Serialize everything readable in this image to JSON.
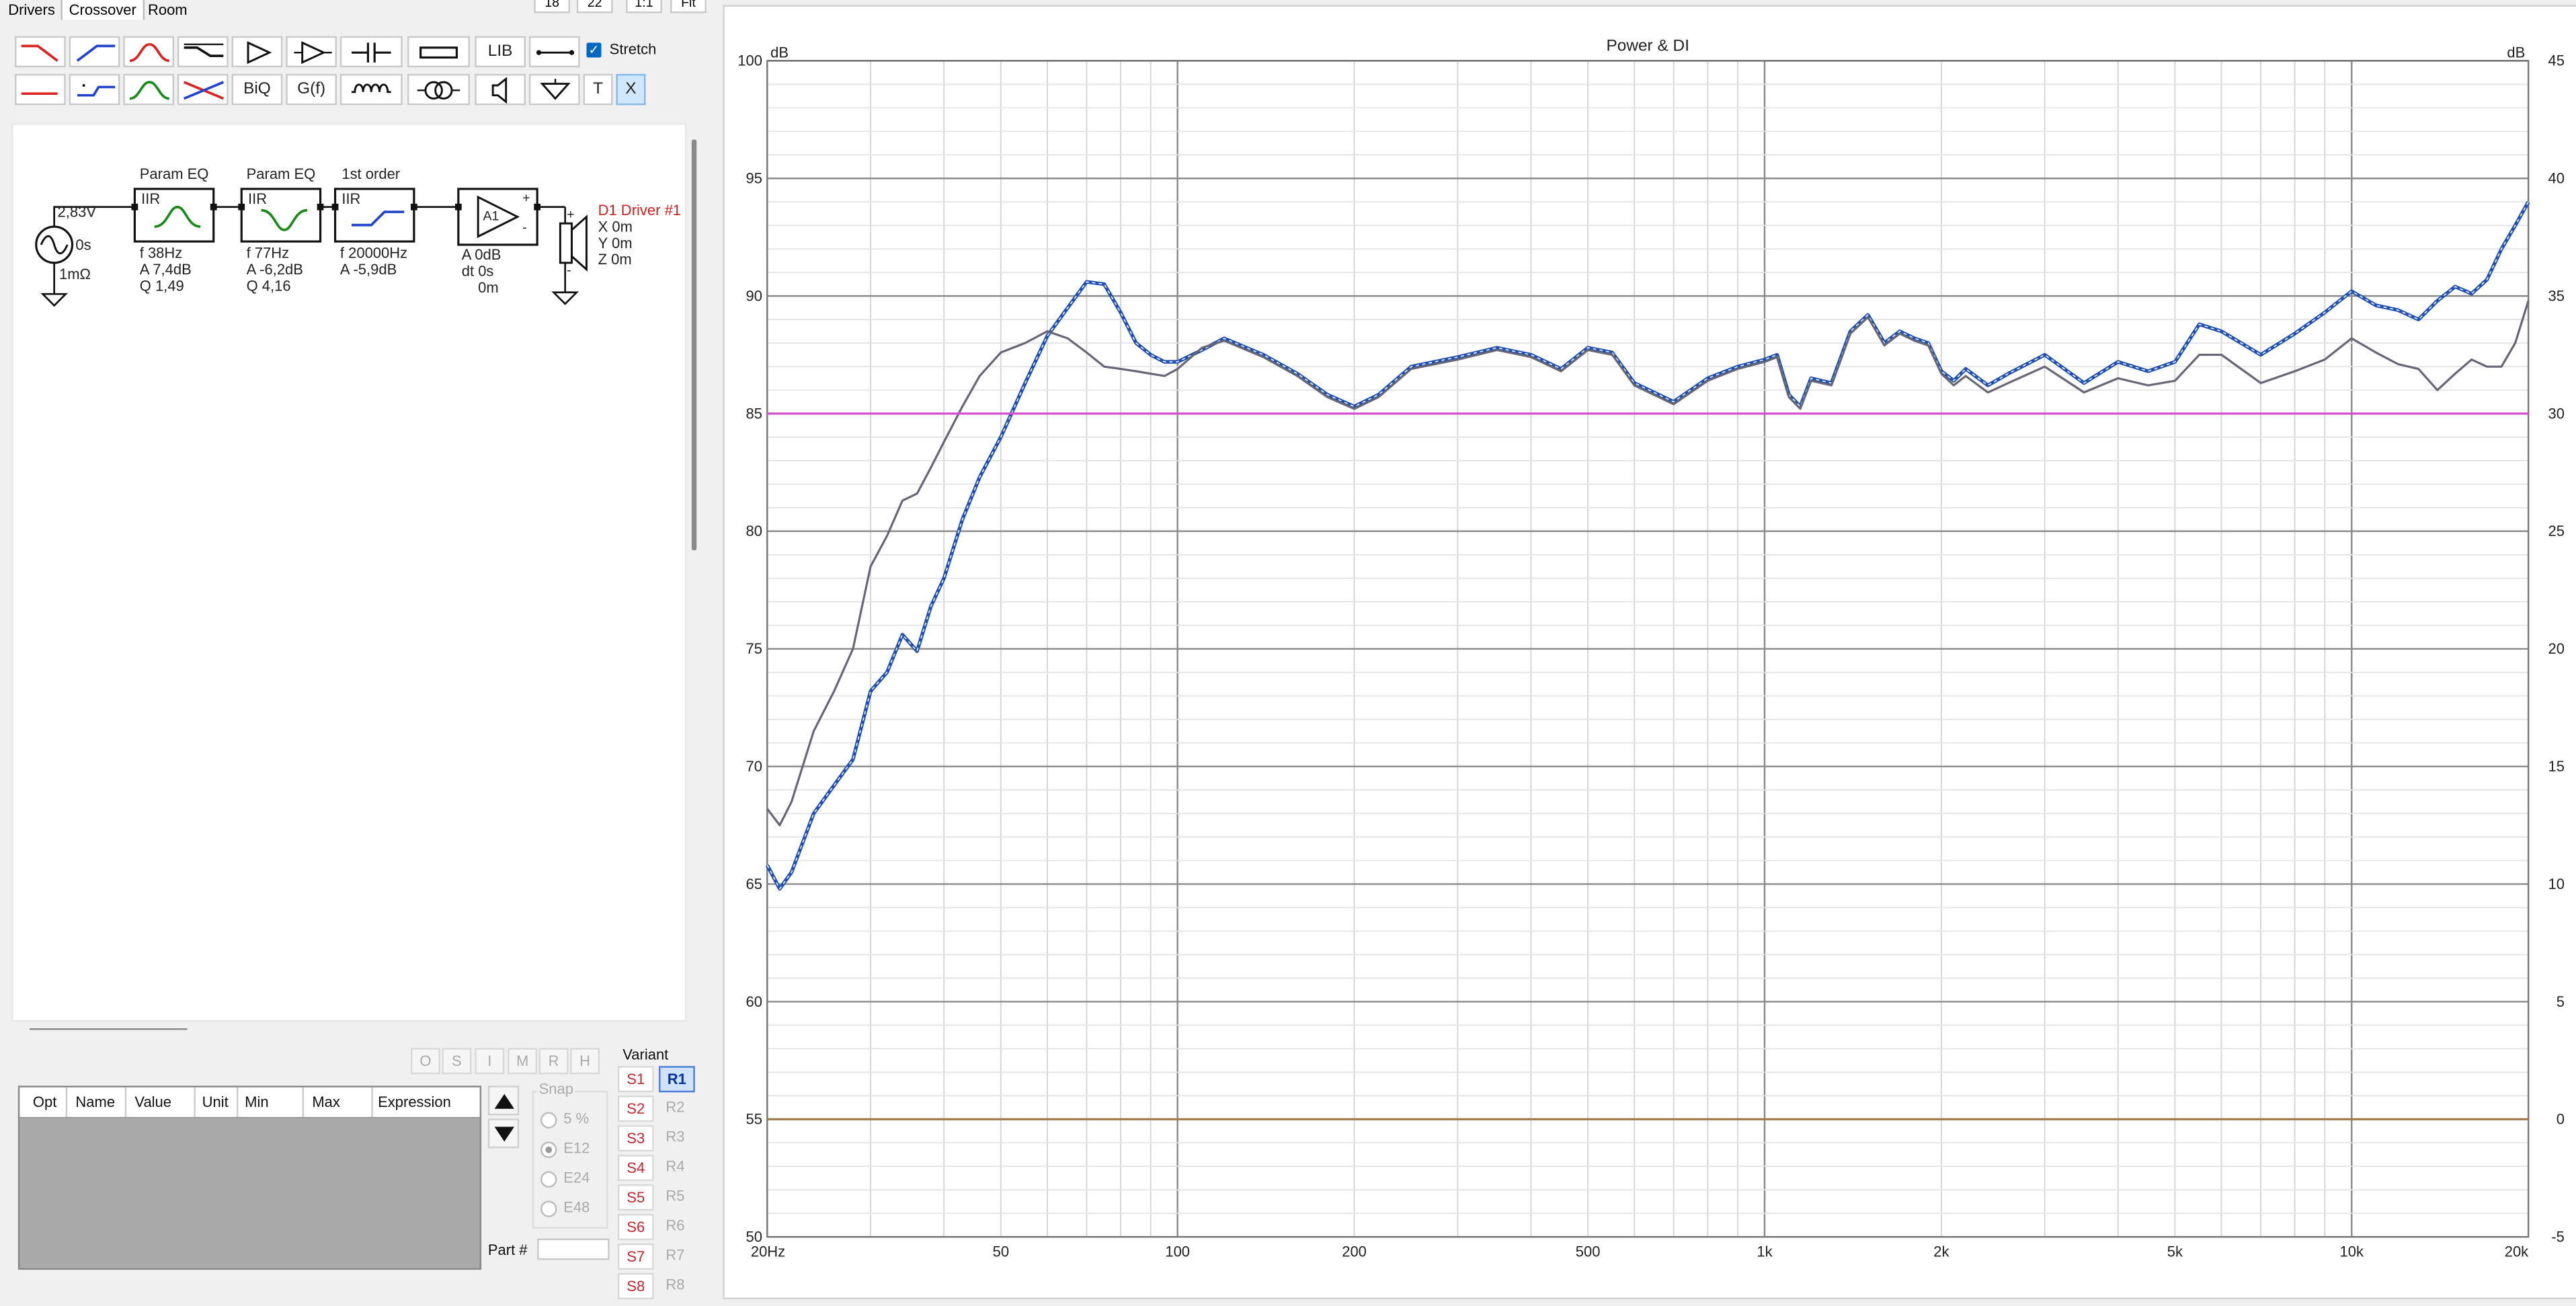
{
  "tabs": [
    {
      "label": "Drivers",
      "active": false
    },
    {
      "label": "Crossover",
      "active": true
    },
    {
      "label": "Room",
      "active": false
    }
  ],
  "top_small_buttons": [
    "18",
    "22",
    "1:1",
    "Fit"
  ],
  "toolbar": {
    "row1_icons": [
      "lowpass-red-icon",
      "highpass-blue-icon",
      "bandpass-red-icon",
      "shelf-black-icon",
      "buffer-triangle-icon",
      "amp-triangle-icon",
      "capacitor-icon",
      "resistor-icon"
    ],
    "row2_icons": [
      "lowpass-red-small-icon",
      "highpass-blue-small-icon",
      "bandpass-green-icon",
      "crossover-x-icon"
    ],
    "lib_label": "LIB",
    "biq_label": "BiQ",
    "gf_label": "G(f)",
    "t_label": "T",
    "x_label": "X",
    "stretch_label": "Stretch",
    "stretch_checked": true
  },
  "schematic": {
    "source": {
      "voltage": "2,83V",
      "delay": "0s",
      "impedance": "1mΩ"
    },
    "blocks": [
      {
        "title": "Param EQ",
        "type": "IIR",
        "params": [
          "f  38Hz",
          "A  7,4dB",
          "Q  1,49"
        ],
        "curve_color": "#1a8a1a",
        "shape": "peak"
      },
      {
        "title": "Param EQ",
        "type": "IIR",
        "params": [
          "f  77Hz",
          "A  -6,2dB",
          "Q  4,16"
        ],
        "curve_color": "#1a8a1a",
        "shape": "dip"
      },
      {
        "title": "1st order",
        "type": "IIR",
        "params": [
          "f  20000Hz",
          "A  -5,9dB"
        ],
        "curve_color": "#2244cc",
        "shape": "highpass"
      }
    ],
    "amp": {
      "label": "A1",
      "params": [
        "A  0dB",
        "dt 0s",
        "0m"
      ]
    },
    "driver": {
      "name": "D1 Driver #1",
      "coords": [
        "X 0m",
        "Y 0m",
        "Z 0m"
      ],
      "color": "#cc2222"
    }
  },
  "opt_buttons": [
    "O",
    "S",
    "I",
    "M",
    "R",
    "H"
  ],
  "param_table": {
    "columns": [
      "Opt",
      "Name",
      "Value",
      "Unit",
      "Min",
      "Max",
      "Expression"
    ]
  },
  "snap": {
    "title": "Snap",
    "options": [
      {
        "label": "5 %",
        "selected": false
      },
      {
        "label": "E12",
        "selected": true
      },
      {
        "label": "E24",
        "selected": false
      },
      {
        "label": "E48",
        "selected": false
      }
    ]
  },
  "part": {
    "label": "Part #",
    "value": ""
  },
  "variant": {
    "title": "Variant",
    "s": [
      "S1",
      "S2",
      "S3",
      "S4",
      "S5",
      "S6",
      "S7",
      "S8"
    ],
    "r": [
      "R1",
      "R2",
      "R3",
      "R4",
      "R5",
      "R6",
      "R7",
      "R8"
    ],
    "active": "R1"
  },
  "chart_data": {
    "type": "line",
    "title": "Power & DI",
    "xscale": "log",
    "xlim": [
      20,
      20000
    ],
    "xticks": [
      {
        "v": 20,
        "label": "20Hz"
      },
      {
        "v": 50,
        "label": "50"
      },
      {
        "v": 100,
        "label": "100"
      },
      {
        "v": 200,
        "label": "200"
      },
      {
        "v": 500,
        "label": "500"
      },
      {
        "v": 1000,
        "label": "1k"
      },
      {
        "v": 2000,
        "label": "2k"
      },
      {
        "v": 5000,
        "label": "5k"
      },
      {
        "v": 10000,
        "label": "10k"
      },
      {
        "v": 20000,
        "label": "20k"
      }
    ],
    "left_axis": {
      "unit": "dB",
      "ylim": [
        50,
        100
      ],
      "ticks": [
        50,
        55,
        60,
        65,
        70,
        75,
        80,
        85,
        90,
        95,
        100
      ]
    },
    "right_axis": {
      "unit": "dB",
      "ylim": [
        -5,
        45
      ],
      "ticks": [
        -5,
        0,
        5,
        10,
        15,
        20,
        25,
        30,
        35,
        40,
        45
      ]
    },
    "grid": true,
    "series": [
      {
        "color": "#1f4fb0",
        "style": "dashed-double",
        "axis": "left",
        "x": [
          20,
          21,
          22,
          24,
          26,
          28,
          30,
          32,
          34,
          36,
          38,
          40,
          43,
          46,
          50,
          55,
          60,
          65,
          70,
          75,
          80,
          85,
          90,
          95,
          100,
          110,
          120,
          140,
          160,
          180,
          200,
          220,
          250,
          300,
          350,
          400,
          450,
          500,
          550,
          600,
          700,
          800,
          900,
          1000,
          1050,
          1100,
          1150,
          1200,
          1300,
          1400,
          1500,
          1600,
          1700,
          1800,
          1900,
          2000,
          2100,
          2200,
          2400,
          2600,
          3000,
          3500,
          4000,
          4500,
          5000,
          5500,
          6000,
          7000,
          8000,
          9000,
          10000,
          11000,
          12000,
          13000,
          14000,
          15000,
          16000,
          17000,
          18000,
          19000,
          20000
        ],
        "y": [
          65.8,
          64.8,
          65.5,
          68.0,
          69.2,
          70.3,
          73.2,
          74.0,
          75.6,
          74.9,
          76.8,
          78.0,
          80.5,
          82.3,
          84.0,
          86.3,
          88.3,
          89.5,
          90.6,
          90.5,
          89.3,
          88.0,
          87.5,
          87.2,
          87.2,
          87.7,
          88.2,
          87.5,
          86.7,
          85.8,
          85.3,
          85.8,
          87.0,
          87.4,
          87.8,
          87.5,
          86.9,
          87.8,
          87.6,
          86.3,
          85.5,
          86.5,
          87.0,
          87.3,
          87.5,
          85.8,
          85.3,
          86.5,
          86.3,
          88.5,
          89.2,
          88.0,
          88.5,
          88.2,
          88.0,
          86.8,
          86.4,
          86.9,
          86.2,
          86.7,
          87.5,
          86.3,
          87.2,
          86.8,
          87.2,
          88.8,
          88.5,
          87.5,
          88.4,
          89.3,
          90.2,
          89.6,
          89.4,
          89.0,
          89.8,
          90.4,
          90.1,
          90.7,
          92.0,
          93.0,
          94.0
        ]
      },
      {
        "color": "#666677",
        "style": "solid",
        "axis": "left",
        "x": [
          20,
          21,
          22,
          24,
          26,
          28,
          30,
          32,
          34,
          36,
          38,
          40,
          43,
          46,
          50,
          55,
          60,
          65,
          70,
          75,
          80,
          85,
          90,
          95,
          100,
          110,
          120,
          140,
          160,
          180,
          200,
          220,
          250,
          300,
          350,
          400,
          450,
          500,
          550,
          600,
          700,
          800,
          900,
          1000,
          1050,
          1100,
          1150,
          1200,
          1300,
          1400,
          1500,
          1600,
          1700,
          1800,
          1900,
          2000,
          2100,
          2200,
          2400,
          2600,
          3000,
          3500,
          4000,
          4500,
          5000,
          5500,
          6000,
          7000,
          8000,
          9000,
          10000,
          11000,
          12000,
          13000,
          14000,
          15000,
          16000,
          17000,
          18000,
          19000,
          20000
        ],
        "y": [
          68.2,
          67.5,
          68.5,
          71.5,
          73.2,
          75.0,
          78.5,
          79.8,
          81.3,
          81.6,
          82.7,
          83.8,
          85.3,
          86.6,
          87.6,
          88.0,
          88.5,
          88.2,
          87.6,
          87.0,
          86.9,
          86.8,
          86.7,
          86.6,
          86.9,
          87.8,
          88.1,
          87.4,
          86.6,
          85.7,
          85.2,
          85.7,
          86.9,
          87.3,
          87.7,
          87.4,
          86.8,
          87.7,
          87.5,
          86.2,
          85.4,
          86.4,
          86.9,
          87.2,
          87.4,
          85.7,
          85.2,
          86.4,
          86.2,
          88.4,
          89.1,
          87.9,
          88.4,
          88.1,
          87.9,
          86.7,
          86.2,
          86.6,
          85.9,
          86.3,
          87.0,
          85.9,
          86.5,
          86.2,
          86.4,
          87.5,
          87.5,
          86.3,
          86.8,
          87.3,
          88.2,
          87.6,
          87.1,
          86.9,
          86.0,
          86.7,
          87.3,
          87.0,
          87.0,
          88.0,
          89.8
        ]
      },
      {
        "color": "#d050d0",
        "style": "solid",
        "axis": "left",
        "x": [
          20,
          20000
        ],
        "y": [
          85,
          85
        ]
      },
      {
        "color": "#a0784a",
        "style": "solid",
        "axis": "right",
        "x": [
          20,
          20000
        ],
        "y": [
          0,
          0
        ]
      }
    ]
  }
}
